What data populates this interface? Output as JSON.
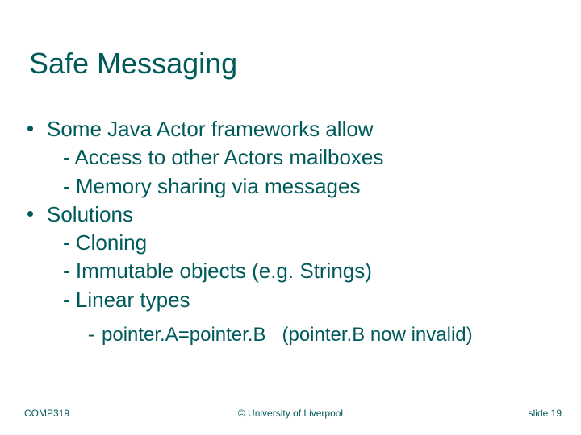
{
  "title": "Safe Messaging",
  "body": {
    "p1": "Some Java Actor frameworks allow",
    "p1a": "- Access to other Actors mailboxes",
    "p1b": "- Memory sharing via messages",
    "p2": "Solutions",
    "p2a": "- Cloning",
    "p2b": "- Immutable objects (e.g. Strings)",
    "p2c": "- Linear types",
    "p3dash": "-",
    "p3": "pointer.A=pointer.B   (pointer.B now invalid)"
  },
  "footer": {
    "left": "COMP319",
    "center": "© University of Liverpool",
    "right": "slide  19"
  }
}
